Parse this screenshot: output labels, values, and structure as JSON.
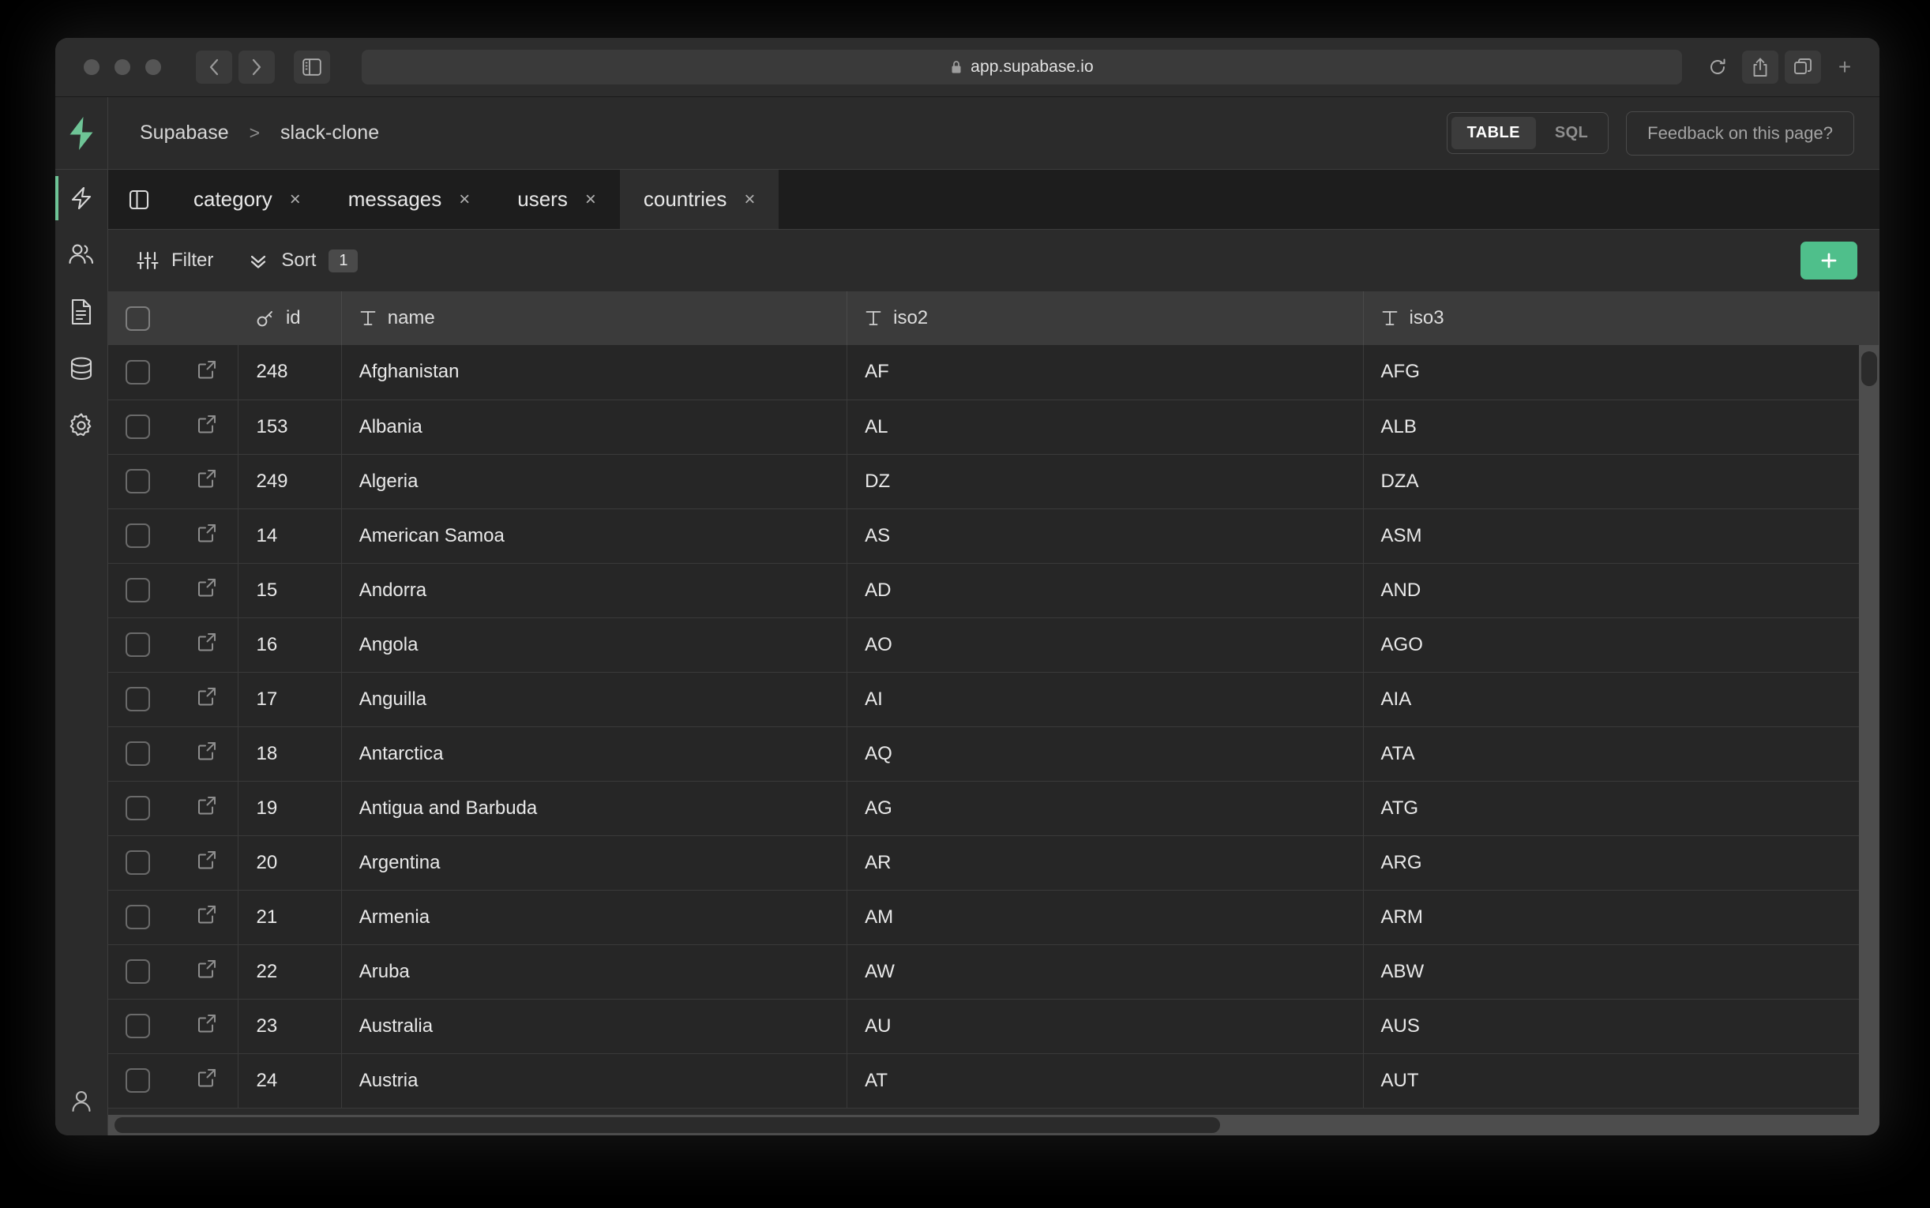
{
  "browser": {
    "url": "app.supabase.io",
    "lock_icon": "lock-icon",
    "back_icon": "chevron-left-icon",
    "forward_icon": "chevron-right-icon",
    "sidebar_icon": "sidebar-panel-icon",
    "reload_icon": "reload-icon",
    "share_icon": "share-icon",
    "tabs_icon": "tab-overview-icon",
    "new_tab_label": "+"
  },
  "rail": {
    "logo_icon": "supabase-logo-icon",
    "items": [
      {
        "icon": "lightning-bolt-icon",
        "name": "rail-item-functions",
        "active": true
      },
      {
        "icon": "users-icon",
        "name": "rail-item-auth",
        "active": false
      },
      {
        "icon": "document-icon",
        "name": "rail-item-docs",
        "active": false
      },
      {
        "icon": "database-icon",
        "name": "rail-item-database",
        "active": false
      },
      {
        "icon": "gear-icon",
        "name": "rail-item-settings",
        "active": false
      }
    ],
    "account_icon": "user-avatar-icon"
  },
  "topbar": {
    "breadcrumb": {
      "org": "Supabase",
      "separator": ">",
      "project": "slack-clone"
    },
    "view_toggle": {
      "options": [
        "TABLE",
        "SQL"
      ],
      "selected": "TABLE"
    },
    "feedback_label": "Feedback on this page?"
  },
  "tabs": {
    "panel_toggle_icon": "sidebar-panel-icon",
    "close_glyph": "×",
    "items": [
      {
        "label": "category",
        "active": false
      },
      {
        "label": "messages",
        "active": false
      },
      {
        "label": "users",
        "active": false
      },
      {
        "label": "countries",
        "active": true
      }
    ]
  },
  "toolbar": {
    "filter_label": "Filter",
    "filter_icon": "filter-sliders-icon",
    "sort_label": "Sort",
    "sort_icon": "chevrons-down-icon",
    "sort_count": "1",
    "add_row_glyph": "+"
  },
  "grid": {
    "columns": [
      {
        "key": "id",
        "label": "id",
        "type_icon": "key-icon"
      },
      {
        "key": "name",
        "label": "name",
        "type_icon": "text-type-icon"
      },
      {
        "key": "iso2",
        "label": "iso2",
        "type_icon": "text-type-icon"
      },
      {
        "key": "iso3",
        "label": "iso3",
        "type_icon": "text-type-icon"
      }
    ],
    "row_expand_icon": "external-link-icon",
    "rows": [
      {
        "id": "248",
        "name": "Afghanistan",
        "iso2": "AF",
        "iso3": "AFG"
      },
      {
        "id": "153",
        "name": "Albania",
        "iso2": "AL",
        "iso3": "ALB"
      },
      {
        "id": "249",
        "name": "Algeria",
        "iso2": "DZ",
        "iso3": "DZA"
      },
      {
        "id": "14",
        "name": "American Samoa",
        "iso2": "AS",
        "iso3": "ASM"
      },
      {
        "id": "15",
        "name": "Andorra",
        "iso2": "AD",
        "iso3": "AND"
      },
      {
        "id": "16",
        "name": "Angola",
        "iso2": "AO",
        "iso3": "AGO"
      },
      {
        "id": "17",
        "name": "Anguilla",
        "iso2": "AI",
        "iso3": "AIA"
      },
      {
        "id": "18",
        "name": "Antarctica",
        "iso2": "AQ",
        "iso3": "ATA"
      },
      {
        "id": "19",
        "name": "Antigua and Barbuda",
        "iso2": "AG",
        "iso3": "ATG"
      },
      {
        "id": "20",
        "name": "Argentina",
        "iso2": "AR",
        "iso3": "ARG"
      },
      {
        "id": "21",
        "name": "Armenia",
        "iso2": "AM",
        "iso3": "ARM"
      },
      {
        "id": "22",
        "name": "Aruba",
        "iso2": "AW",
        "iso3": "ABW"
      },
      {
        "id": "23",
        "name": "Australia",
        "iso2": "AU",
        "iso3": "AUS"
      },
      {
        "id": "24",
        "name": "Austria",
        "iso2": "AT",
        "iso3": "AUT"
      }
    ]
  },
  "colors": {
    "accent_green": "#4fbf8b",
    "logo_green": "#6ec496",
    "grid_bg": "#262626",
    "header_bg": "#3b3b3b",
    "chrome_bg": "#2d2d2d"
  }
}
